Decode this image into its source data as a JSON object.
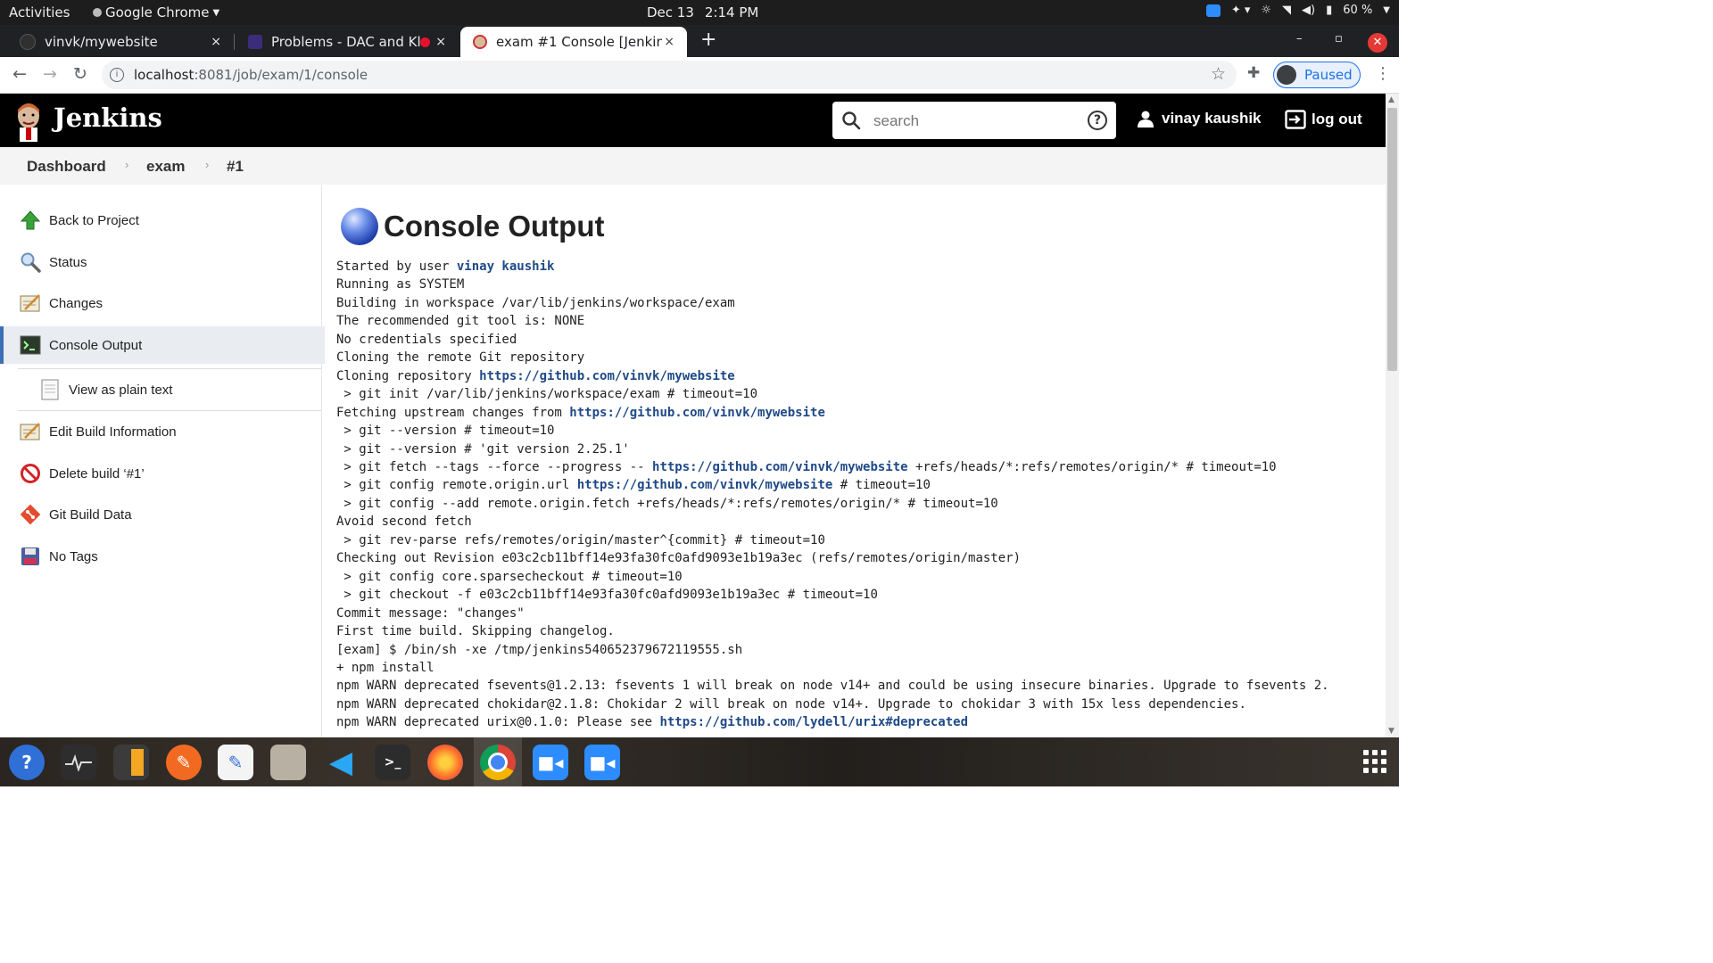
{
  "system_bar": {
    "activities": "Activities",
    "app_name": "Google Chrome",
    "date": "Dec 13",
    "time": "2:14 PM",
    "battery": "60 %"
  },
  "browser": {
    "tabs": [
      {
        "title": "vinvk/mywebsite",
        "close": "×"
      },
      {
        "title": "Problems - DAC and Kl",
        "close": "×"
      },
      {
        "title": "exam #1 Console [Jenkins]",
        "close": "×"
      }
    ],
    "new_tab": "+",
    "url_host": "localhost",
    "url_path": ":8081/job/exam/1/console",
    "profile_status": "Paused"
  },
  "jenkins": {
    "title": "Jenkins",
    "search_placeholder": "search",
    "help": "?",
    "user": "vinay kaushik",
    "logout": "log out"
  },
  "breadcrumb": [
    "Dashboard",
    "exam",
    "#1"
  ],
  "sidebar": [
    {
      "label": "Back to Project",
      "icon": "up-arrow-icon"
    },
    {
      "label": "Status",
      "icon": "magnifier-icon"
    },
    {
      "label": "Changes",
      "icon": "notepad-icon"
    },
    {
      "label": "Console Output",
      "icon": "terminal-icon",
      "active": true
    },
    {
      "label": "View as plain text",
      "icon": "document-icon",
      "sub": true
    },
    {
      "label": "Edit Build Information",
      "icon": "notepad-icon"
    },
    {
      "label": "Delete build ‘#1’",
      "icon": "no-entry-icon"
    },
    {
      "label": "Git Build Data",
      "icon": "git-icon"
    },
    {
      "label": "No Tags",
      "icon": "floppy-icon"
    }
  ],
  "main": {
    "heading": "Console Output",
    "console_lines": [
      [
        "Started by user ",
        {
          "link": "vinay kaushik"
        }
      ],
      [
        "Running as SYSTEM"
      ],
      [
        "Building in workspace /var/lib/jenkins/workspace/exam"
      ],
      [
        "The recommended git tool is: NONE"
      ],
      [
        "No credentials specified"
      ],
      [
        "Cloning the remote Git repository"
      ],
      [
        "Cloning repository ",
        {
          "link": "https://github.com/vinvk/mywebsite"
        }
      ],
      [
        " > git init /var/lib/jenkins/workspace/exam # timeout=10"
      ],
      [
        "Fetching upstream changes from ",
        {
          "link": "https://github.com/vinvk/mywebsite"
        }
      ],
      [
        " > git --version # timeout=10"
      ],
      [
        " > git --version # 'git version 2.25.1'"
      ],
      [
        " > git fetch --tags --force --progress -- ",
        {
          "link": "https://github.com/vinvk/mywebsite"
        },
        " +refs/heads/*:refs/remotes/origin/* # timeout=10"
      ],
      [
        " > git config remote.origin.url ",
        {
          "link": "https://github.com/vinvk/mywebsite"
        },
        " # timeout=10"
      ],
      [
        " > git config --add remote.origin.fetch +refs/heads/*:refs/remotes/origin/* # timeout=10"
      ],
      [
        "Avoid second fetch"
      ],
      [
        " > git rev-parse refs/remotes/origin/master^{commit} # timeout=10"
      ],
      [
        "Checking out Revision e03c2cb11bff14e93fa30fc0afd9093e1b19a3ec (refs/remotes/origin/master)"
      ],
      [
        " > git config core.sparsecheckout # timeout=10"
      ],
      [
        " > git checkout -f e03c2cb11bff14e93fa30fc0afd9093e1b19a3ec # timeout=10"
      ],
      [
        "Commit message: \"changes\""
      ],
      [
        "First time build. Skipping changelog."
      ],
      [
        "[exam] $ /bin/sh -xe /tmp/jenkins540652379672119555.sh"
      ],
      [
        "+ npm install"
      ],
      [
        "npm WARN deprecated fsevents@1.2.13: fsevents 1 will break on node v14+ and could be using insecure binaries. Upgrade to fsevents 2."
      ],
      [
        "npm WARN deprecated chokidar@2.1.8: Chokidar 2 will break on node v14+. Upgrade to chokidar 3 with 15x less dependencies."
      ],
      [
        "npm WARN deprecated urix@0.1.0: Please see ",
        {
          "link": "https://github.com/lydell/urix#deprecated"
        }
      ]
    ]
  },
  "colors": {
    "jenkins_header": "#000000",
    "link": "#204a87",
    "active_item_bg": "#e9ecf0",
    "active_item_border": "#3d6fb6"
  }
}
